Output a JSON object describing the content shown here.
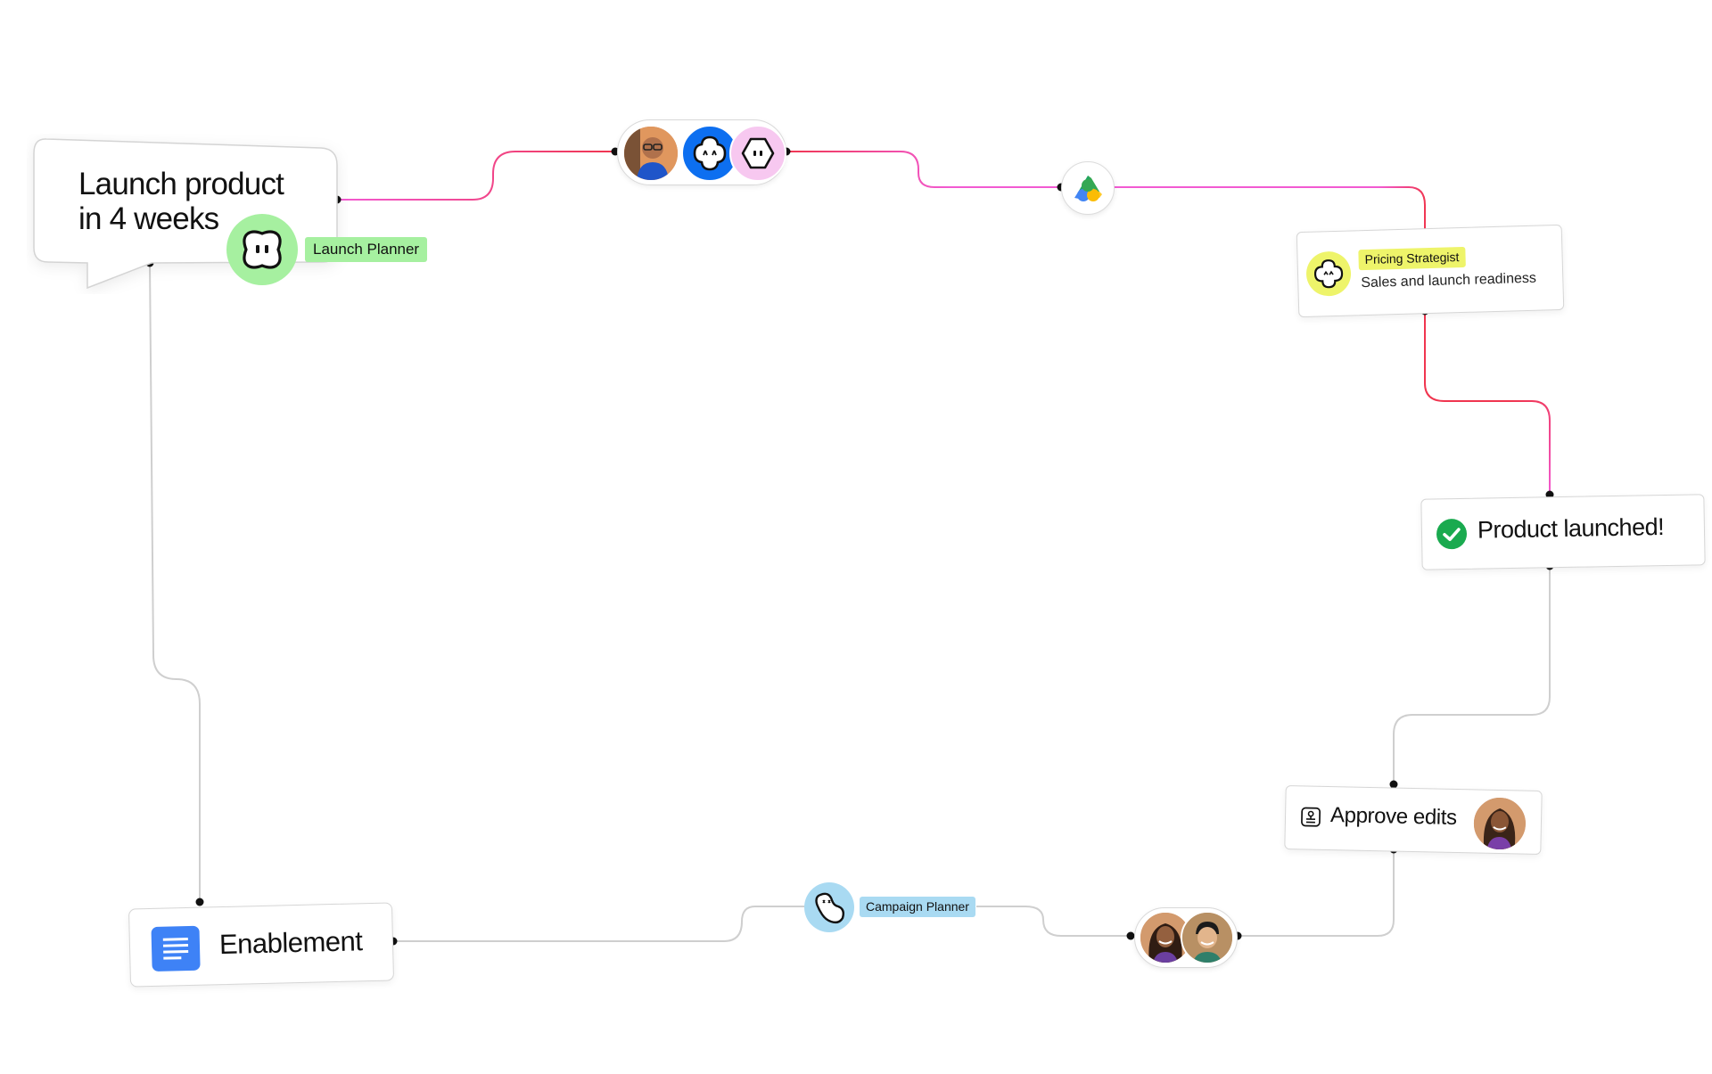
{
  "goal": {
    "line1": "Launch product",
    "line2": "in 4 weeks"
  },
  "agents": {
    "launch_planner": "Launch Planner",
    "pricing_strategist": "Pricing Strategist",
    "campaign_planner": "Campaign Planner"
  },
  "pricing_card": {
    "subtitle": "Sales and launch readiness"
  },
  "milestone": {
    "label": "Product launched!"
  },
  "approval": {
    "label": "Approve edits"
  },
  "document": {
    "label": "Enablement"
  },
  "icons": {
    "launch_planner": "blob-face-icon",
    "pricing_strategist": "flower-face-icon",
    "campaign_planner": "peanut-face-icon",
    "drive": "google-drive-icon",
    "check": "check-circle-icon",
    "approve": "stamp-icon",
    "document": "google-docs-icon"
  },
  "colors": {
    "launch_planner": "#a6f0a0",
    "pricing_strategist": "#eef46a",
    "campaign_planner": "#a9daf2",
    "connector_pink": "#f25ad2",
    "connector_red": "#f0354f",
    "connector_gray": "#cfcfcf",
    "check": "#1aaa4f",
    "docs": "#3e82f6"
  }
}
